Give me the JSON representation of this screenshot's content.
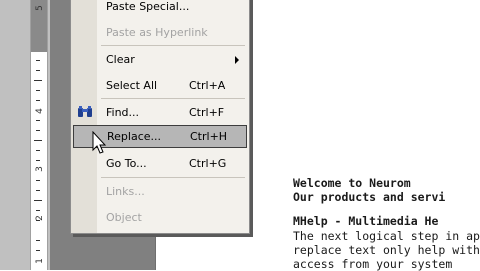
{
  "ruler": {
    "numbers": [
      "5",
      "4",
      "3",
      "2",
      "1"
    ]
  },
  "menu": {
    "items": [
      {
        "label": "Paste Special...",
        "accel": "",
        "disabled": false
      },
      {
        "label": "Paste as Hyperlink",
        "accel": "",
        "disabled": true
      },
      {
        "label": "Clear",
        "accel": "",
        "disabled": false,
        "submenu": true
      },
      {
        "label": "Select All",
        "accel": "Ctrl+A",
        "disabled": false
      },
      {
        "label": "Find...",
        "accel": "Ctrl+F",
        "disabled": false,
        "icon": "binoculars-icon"
      },
      {
        "label": "Replace...",
        "accel": "Ctrl+H",
        "disabled": false,
        "highlighted": true
      },
      {
        "label": "Go To...",
        "accel": "Ctrl+G",
        "disabled": false
      },
      {
        "label": "Links...",
        "accel": "",
        "disabled": true
      },
      {
        "label": "Object",
        "accel": "",
        "disabled": true
      }
    ]
  },
  "document": {
    "line1": "Welcome to Neurom",
    "line2": "Our products and servi",
    "line3": "MHelp - Multimedia He",
    "line4": "The next logical step in ap",
    "line5": "replace text only help with",
    "line6": "access from your system"
  },
  "colors": {
    "highlight": "#b6b6b6",
    "menu_bg": "#f3f1ec",
    "app_bg": "#808080"
  }
}
